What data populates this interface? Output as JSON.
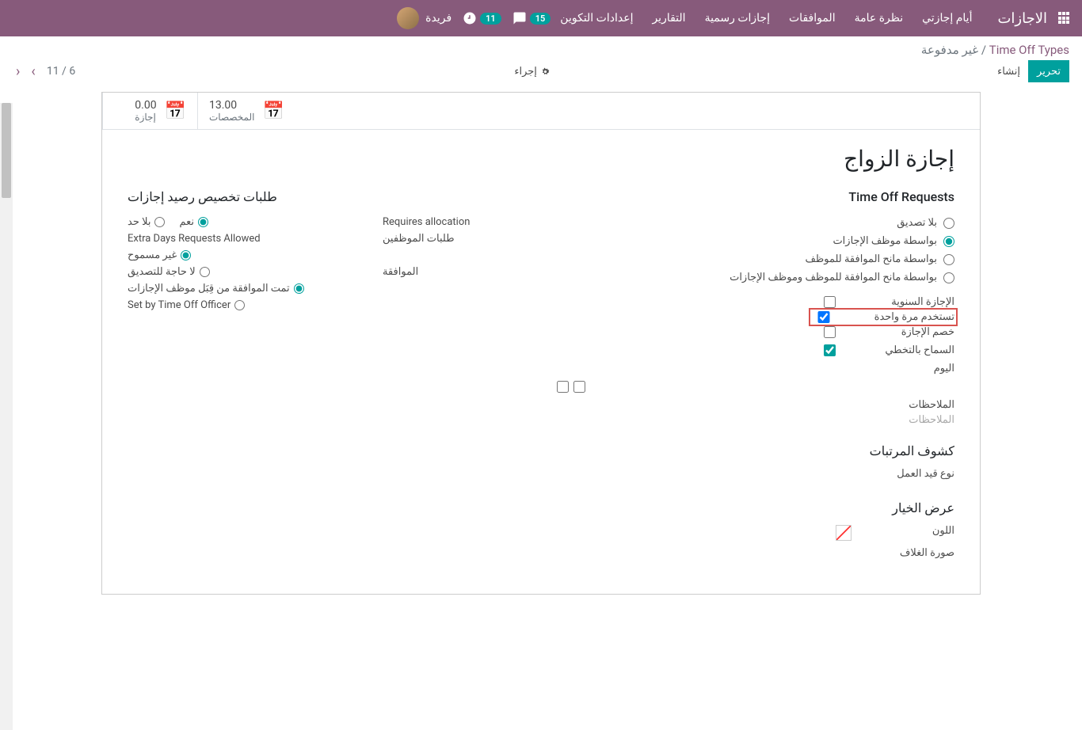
{
  "nav": {
    "brand": "الاجازات",
    "items": [
      "أيام إجازتي",
      "نظرة عامة",
      "الموافقات",
      "إجازات رسمية",
      "التقارير",
      "إعدادات التكوين"
    ],
    "msg_count": "15",
    "act_count": "11",
    "username": "فريدة"
  },
  "breadcrumb": {
    "root": "Time Off Types",
    "current": "غير مدفوعة"
  },
  "actions": {
    "edit": "تحرير",
    "create": "إنشاء",
    "action": "إجراء",
    "pager": "6 / 11"
  },
  "stats": {
    "alloc_num": "13.00",
    "alloc_label": "المخصصات",
    "leave_num": "0.00",
    "leave_label": "إجازة"
  },
  "form": {
    "title": "إجازة الزواج",
    "req_title": "Time Off Requests",
    "req_opts": [
      "بلا تصديق",
      "بواسطة موظف الإجازات",
      "بواسطة مانح الموافقة للموظف",
      "بواسطة مانح الموافقة للموظف وموظف الإجازات"
    ],
    "cb_annual": "الإجازة السنوية",
    "cb_once": "تستخدم مرة واحدة",
    "cb_deduct": "خصم الإجازة",
    "cb_allow_skip": "السماح بالتخطي",
    "day_label": "اليوم",
    "notes_label": "الملاحظات",
    "notes_placeholder": "الملاحظات",
    "alloc_title": "طلبات تخصيص رصيد إجازات",
    "requires_alloc_label": "Requires allocation",
    "requires_alloc_opts": [
      "نعم",
      "بلا حد"
    ],
    "emp_req_label": "طلبات الموظفين",
    "extra_days_label": "Extra Days Requests Allowed",
    "extra_days_opt": "غير مسموح",
    "approval_label": "الموافقة",
    "approval_opts": [
      "لا حاجة للتصديق",
      "تمت الموافقة من قِبَل موظف الإجازات",
      "Set by Time Off Officer"
    ],
    "payroll_title": "كشوف المرتبات",
    "work_entry_label": "نوع قيد العمل",
    "display_title": "عرض الخيار",
    "color_label": "اللون",
    "cover_label": "صورة الغلاف"
  }
}
